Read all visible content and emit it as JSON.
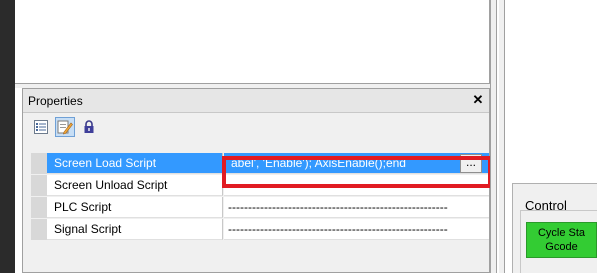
{
  "properties_panel": {
    "title": "Properties",
    "close_glyph": "✕",
    "toolbar": [
      {
        "name": "categorized-list-icon"
      },
      {
        "name": "edit-script-icon"
      },
      {
        "name": "lock-icon"
      }
    ],
    "rows": [
      {
        "name": "Screen Load Script",
        "value": "abel', 'Enable');    AxisEnable();end",
        "selected": true
      },
      {
        "name": "Screen Unload Script",
        "value": "-------------------------------------------------------"
      },
      {
        "name": "PLC Script",
        "value": "-------------------------------------------------------"
      },
      {
        "name": "Signal Script",
        "value": "-------------------------------------------------------"
      }
    ],
    "ellipsis_label": "..."
  },
  "control_panel": {
    "label": "Control",
    "cycle_button_line1": "Cycle Sta",
    "cycle_button_line2": "Gcode"
  },
  "colors": {
    "selection": "#3399ff",
    "highlight_border": "#e11b22",
    "cycle_button": "#33cc33"
  }
}
